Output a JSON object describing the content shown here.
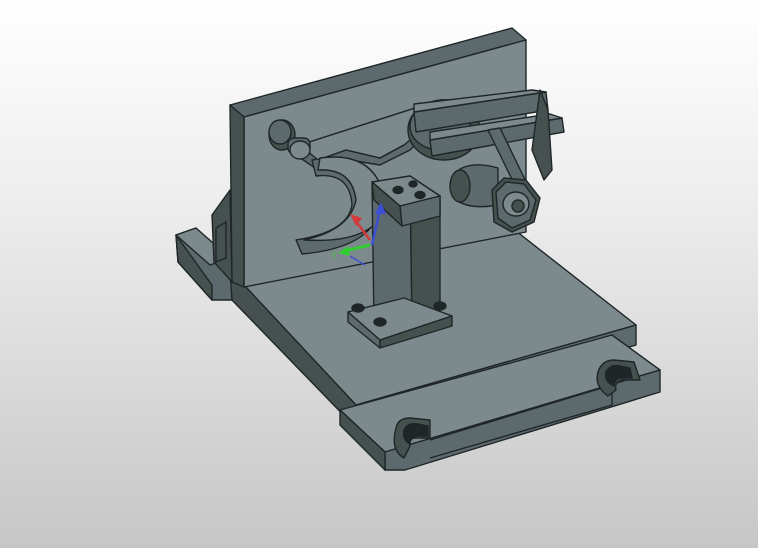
{
  "viewport": {
    "background_top": "#ffffff",
    "background_bottom": "#c6c6c6"
  },
  "model": {
    "face_top": "#7d8a8d",
    "face_side": "#5d6a6d",
    "face_dark": "#46514f",
    "edge": "#1f2628"
  },
  "triad": {
    "x_axis_color": "#d33a3a",
    "y_axis_color": "#33cc33",
    "z_axis_color": "#3a4fd3",
    "y_label": "Y"
  }
}
